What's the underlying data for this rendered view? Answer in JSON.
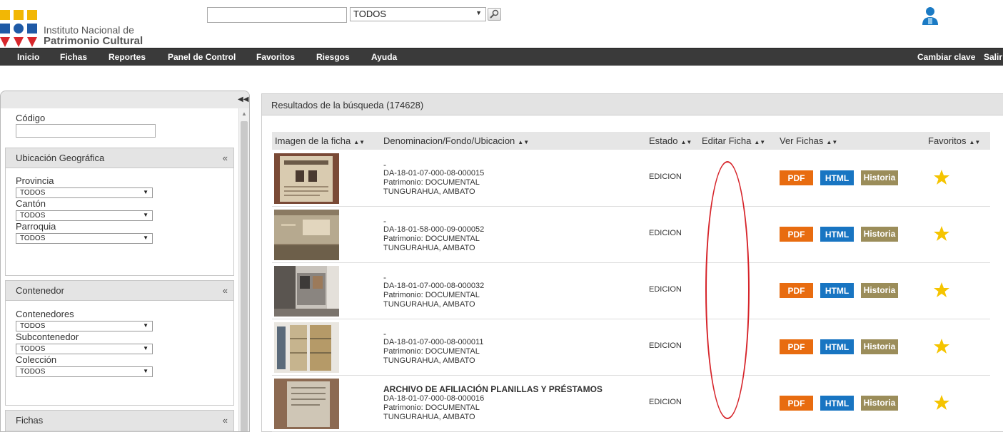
{
  "header": {
    "logo_line1": "Instituto Nacional de",
    "logo_line2": "Patrimonio Cultural",
    "search_placeholder": "",
    "search_type": "TODOS"
  },
  "nav": {
    "items": [
      "Inicio",
      "Fichas",
      "Reportes",
      "Panel de Control",
      "Favoritos",
      "Riesgos",
      "Ayuda"
    ],
    "right_items": [
      "Cambiar clave",
      "Salir"
    ]
  },
  "sidebar": {
    "codigo_label": "Código",
    "ubicacion": {
      "title": "Ubicación Geográfica",
      "toggle": "«",
      "fields": [
        {
          "label": "Provincia",
          "value": "TODOS"
        },
        {
          "label": "Cantón",
          "value": "TODOS"
        },
        {
          "label": "Parroquia",
          "value": "TODOS"
        }
      ]
    },
    "contenedor": {
      "title": "Contenedor",
      "toggle": "«",
      "fields": [
        {
          "label": "Contenedores",
          "value": "TODOS"
        },
        {
          "label": "Subcontenedor",
          "value": "TODOS"
        },
        {
          "label": "Colección",
          "value": "TODOS"
        }
      ]
    },
    "fichas": {
      "title": "Fichas",
      "toggle": "«"
    }
  },
  "results": {
    "title": "Resultados de la búsqueda (174628)",
    "columns": [
      "Imagen de la ficha",
      "Denominacion/Fondo/Ubicacion",
      "Estado",
      "Editar Ficha",
      "Ver Fichas",
      "Favoritos"
    ],
    "buttons": {
      "pdf": "PDF",
      "html": "HTML",
      "historia": "Historia"
    },
    "rows": [
      {
        "title": "-",
        "code": "DA-18-01-07-000-08-000015",
        "patrimonio": "Patrimonio: DOCUMENTAL",
        "ubicacion": "TUNGURAHUA, AMBATO",
        "estado": "EDICION"
      },
      {
        "title": "-",
        "code": "DA-18-01-58-000-09-000052",
        "patrimonio": "Patrimonio: DOCUMENTAL",
        "ubicacion": "TUNGURAHUA, AMBATO",
        "estado": "EDICION"
      },
      {
        "title": "-",
        "code": "DA-18-01-07-000-08-000032",
        "patrimonio": "Patrimonio: DOCUMENTAL",
        "ubicacion": "TUNGURAHUA, AMBATO",
        "estado": "EDICION"
      },
      {
        "title": "-",
        "code": "DA-18-01-07-000-08-000011",
        "patrimonio": "Patrimonio: DOCUMENTAL",
        "ubicacion": "TUNGURAHUA, AMBATO",
        "estado": "EDICION"
      },
      {
        "title": "ARCHIVO DE AFILIACIÓN PLANILLAS Y PRÉSTAMOS",
        "code": "DA-18-01-07-000-08-000016",
        "patrimonio": "Patrimonio: DOCUMENTAL",
        "ubicacion": "TUNGURAHUA, AMBATO",
        "estado": "EDICION"
      }
    ]
  },
  "colors": {
    "nav_bg": "#3a3a3a",
    "pdf": "#e86c10",
    "html": "#1875c2",
    "historia": "#9b8d5a",
    "star": "#f5c400",
    "annotation": "#d6242a"
  }
}
